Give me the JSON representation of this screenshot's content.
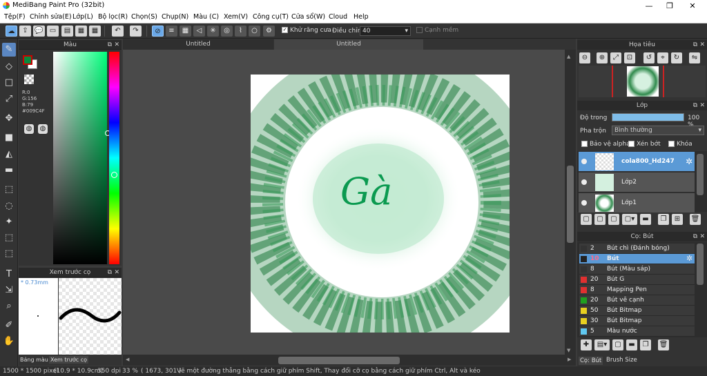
{
  "window": {
    "title": "MediBang Paint Pro (32bit)",
    "minimize": "—",
    "maximize": "❐",
    "close": "✕"
  },
  "menu": [
    "Tệp(F)",
    "Chỉnh sửa(E)",
    "Lớp(L)",
    "Bộ lọc(R)",
    "Chọn(S)",
    "Chụp(N)",
    "Màu (C)",
    "Xem(V)",
    "Công cụ(T)",
    "Cửa sổ(W)",
    "Cloud",
    "Help"
  ],
  "toolbar": {
    "antialias_label": "Khử răng cưa",
    "adjust_label": "Điều chỉnh",
    "adjust_value": "40",
    "smooth_label": "Cạnh mềm"
  },
  "color_panel": {
    "title": "Màu",
    "r": "R:0",
    "g": "G:156",
    "b": "B:79",
    "hex": "#009C4F",
    "primary_color": "#009C4F"
  },
  "brush_preview": {
    "title": "Xem trước cọ",
    "size": "* 0.73mm"
  },
  "left_bottom_tabs": {
    "color_bar": "Bảng màu",
    "brush_preview": "Xem trước cọ"
  },
  "doc_tabs": [
    "Untitled",
    "Untitled"
  ],
  "canvas": {
    "text": "Gà",
    "text_color": "#0b9a50"
  },
  "navigator": {
    "title": "Họa tiêu"
  },
  "layers": {
    "title": "Lớp",
    "opacity_label": "Độ trong",
    "opacity_value": "100 %",
    "opacity_fraction": 1.0,
    "blend_label": "Pha trộn",
    "blend_value": "Bình thường",
    "protect_alpha": "Bảo vệ alpha",
    "clipping": "Xén bớt",
    "lock": "Khóa",
    "items": [
      {
        "name": "cola800_Hd247",
        "selected": true
      },
      {
        "name": "Lớp2",
        "selected": false
      },
      {
        "name": "Lớp1",
        "selected": false
      }
    ]
  },
  "brushes": {
    "title": "Cọ: Bút",
    "items": [
      {
        "size": "2",
        "name": "Bút chì (Đánh bóng)",
        "color": "#333333"
      },
      {
        "size": "10",
        "name": "Bút",
        "color": "#222222",
        "selected": true
      },
      {
        "size": "8",
        "name": "Bút (Màu sáp)",
        "color": "#333333"
      },
      {
        "size": "20",
        "name": "Bút G",
        "color": "#e03030"
      },
      {
        "size": "8",
        "name": "Mapping Pen",
        "color": "#e03030"
      },
      {
        "size": "20",
        "name": "Bút vẽ cạnh",
        "color": "#20a020"
      },
      {
        "size": "50",
        "name": "Bút Bitmap",
        "color": "#e8d020"
      },
      {
        "size": "30",
        "name": "Bút Bitmap",
        "color": "#e8d020"
      },
      {
        "size": "5",
        "name": "Màu nước",
        "color": "#60c8f0"
      }
    ],
    "tab_brush": "Cọ: Bút",
    "tab_size": "Brush Size"
  },
  "status": {
    "size": "1500 * 1500 pixel",
    "cm": "(10.9 * 10.9cm)",
    "dpi": "350 dpi",
    "zoom": "33 %",
    "coords": "( 1673, 301 )",
    "hint": "Vẽ một đường thẳng bằng cách giữ phím Shift, Thay đổi cỡ cọ bằng cách giữ phím Ctrl, Alt và kéo"
  }
}
